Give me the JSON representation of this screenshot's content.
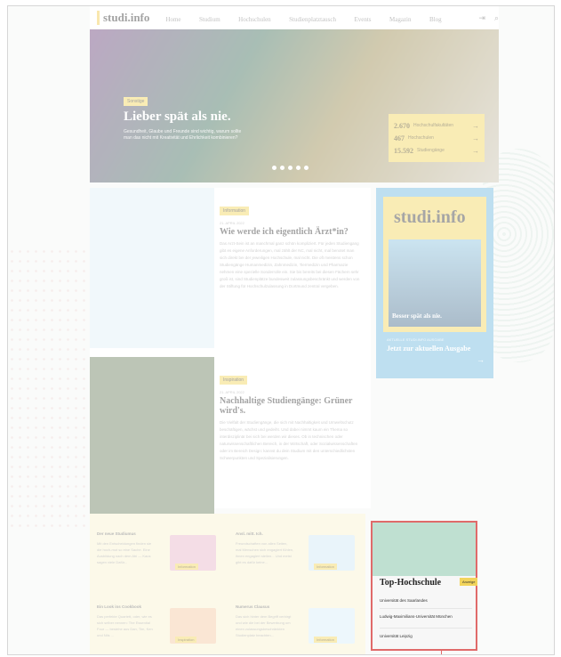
{
  "header": {
    "logo": "studi.info",
    "nav": [
      "Home",
      "Studium",
      "Hochschulen",
      "Studienplatztausch",
      "Events",
      "Magazin",
      "Blog"
    ],
    "login_icon": "login-icon",
    "search_icon": "search-icon"
  },
  "hero": {
    "tag": "Sonstige",
    "title": "Lieber spät als nie.",
    "text": "Gesundheit, Glaube und Freunde sind wichtig, warum sollte man das nicht mit Kreativität und Ehrlichkeit kombinieren?",
    "stats": [
      {
        "num": "2.670",
        "label": "Hochschulfakultäten"
      },
      {
        "num": "467",
        "label": "Hochschulen"
      },
      {
        "num": "15.592",
        "label": "Studiengänge"
      }
    ]
  },
  "articles": [
    {
      "tag": "Information",
      "date": "21. APRIL 2022",
      "title": "Wie werde ich eigentlich Ärzt*in?",
      "body": "Das Arzt-Sein ist an manchmal ganz schön kompliziert. Für jeden Studiengang gibt es eigene Anforderungen, mal zählt der NC, mal nicht, mal benotet man sich direkt bei der jeweiligen Hochschule, mal nicht. Die oft meistens schon Studiengänge Humanmedizin, Zahnmedizin, Tiermedizin und Pharmazie nehmen eine spezielle Sonderrolle ein. Sie bis bereits bei diesen Fächern sehr groß ist, sind Studienplätze bundesweit zulassungsbeschränkt und werden von der Stiftung für Hochschulzulassung in Dortmund zentral vergeben."
    },
    {
      "tag": "Inspiration",
      "date": "21. APRIL 2022",
      "title": "Nachhaltige Studiengänge: Grüner wird's.",
      "body": "Die Vielfalt der Studiengänge, die sich mit Nachhaltigkeit und Umweltschutz beschäftigen, wächst und gedeiht. Und dabei nimmt kaum ein Thema so interdisziplinär bei sich bei werden wir dieses. Ob in technischen oder naturwissenschaftlichen Bereich, in der Wirtschaft, oder Sozialwissenschaften oder im Bereich Design: kannst du dein Studium mit den unterschiedlichsten Schwerpunkten und Spezialisierungen."
    }
  ],
  "magazine": {
    "cover_title": "studi.info",
    "cover_headline": "Besser spät als nie.",
    "label": "AKTUELLE STUDI.INFO AUSGABE",
    "link": "Jetzt zur aktuellen Ausgabe",
    "arrow_icon": "arrow-right-icon"
  },
  "cards": [
    {
      "title": "Der neue Studiumus",
      "desc": "Mit den Entscheidungen finden sie die hoch-mut so eine Sache. Eine Ausbildung nach dem Abi — Kaus sagen viele Dafür...",
      "badge": "Information"
    },
    {
      "title": "Ansl. mitt. Ich.",
      "desc": "Freundschaften von allen Seiten, mal Menschen sich engagiert fühlen, ihnen engagiert stellen... Und meist gibt es dafür keine...",
      "badge": "Information"
    },
    {
      "title": "Ein Look ins Cookbook",
      "desc": "Das perfekte Quartett, oder, wie es sich selber nennen: The Essential Four — bestehe aus Dan, Tim, Ken und Nils ...",
      "badge": "Inspiration"
    },
    {
      "title": "Numerus Clausus",
      "desc": "Das sich hinter dem Begriff verbirgt und wie die bei der Bewerbung um einen zulassungsbeschränkten Studienplatz beachten...",
      "badge": "Information"
    }
  ],
  "top_hochschule": {
    "title": "Top-Hochschule",
    "badge": "Anzeige",
    "items": [
      "Universität des Saarlandes",
      "Ludwig-Maximilians-Universität München",
      "Universität Leipzig"
    ]
  }
}
